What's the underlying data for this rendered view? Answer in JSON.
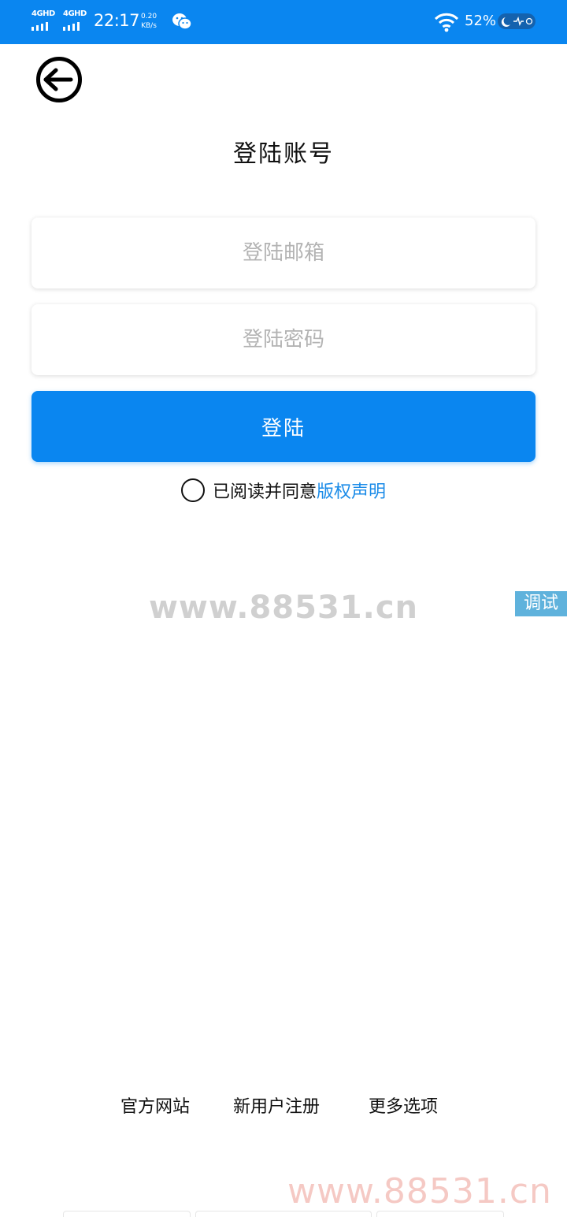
{
  "status_bar": {
    "signal_1_label": "4GHD",
    "signal_2_label": "4GHD",
    "time": "22:17",
    "speed_value": "0.20",
    "speed_unit": "KB/s",
    "battery": "52%",
    "bg_color": "#0a86f0"
  },
  "header": {
    "back_icon": "back-arrow-circle-icon",
    "title": "登陆账号"
  },
  "form": {
    "email_placeholder": "登陆邮箱",
    "password_placeholder": "登陆密码",
    "login_label": "登陆",
    "accent_color": "#0a86f0"
  },
  "agreement": {
    "text": "已阅读并同意",
    "link": "版权声明",
    "checked": false
  },
  "watermark": {
    "center": "www.88531.cn",
    "bottom": "www.88531.cn"
  },
  "debug_label": "调试",
  "footer": {
    "links": [
      "官方网站",
      "新用户注册",
      "更多选项"
    ]
  }
}
